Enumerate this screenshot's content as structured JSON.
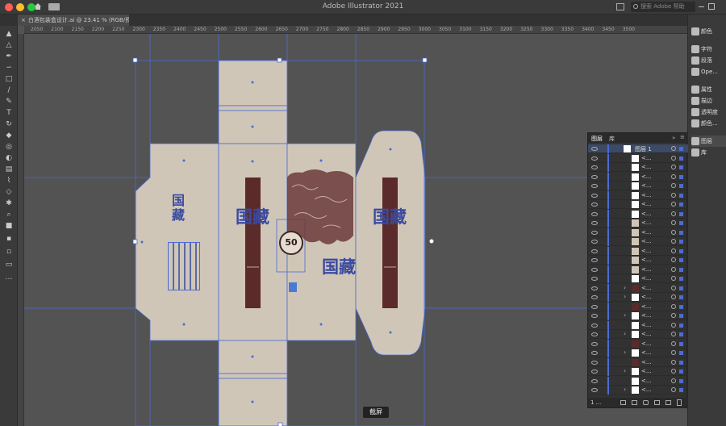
{
  "titlebar": {
    "app_title": "Adobe Illustrator 2021",
    "search_placeholder": "搜索 Adobe 帮助"
  },
  "document_tab": {
    "label": "白酒包装盒设计.ai @ 23.41 % (RGB/预览)",
    "close": "×"
  },
  "ruler_top": [
    "2050",
    "2100",
    "2150",
    "2200",
    "2250",
    "2300",
    "2350",
    "2400",
    "2450",
    "2500",
    "2550",
    "2600",
    "2650",
    "2700",
    "2750",
    "2800",
    "2850",
    "2900",
    "2950",
    "3000",
    "3050",
    "3100",
    "3150",
    "3200",
    "3250",
    "3300",
    "3350",
    "3400",
    "3450",
    "3500"
  ],
  "right_panel": {
    "items": [
      "颜色",
      "字符",
      "段落",
      "Ope...",
      "属性",
      "描边",
      "透明度",
      "颜色...",
      "图层",
      "库"
    ]
  },
  "layers_panel": {
    "tabs": [
      "图层",
      "库"
    ],
    "layer_name": "图层 1",
    "sublayer_label": "<...",
    "footer_count": "1 ..."
  },
  "artwork": {
    "brand_text": "国藏",
    "badge_text": "50"
  },
  "tooltip": {
    "label": "截屏"
  },
  "colors": {
    "accent": "#1473e6",
    "box": "#d0c6b8",
    "ink": "#3a4aa0",
    "maroon": "#5b2a2a"
  }
}
